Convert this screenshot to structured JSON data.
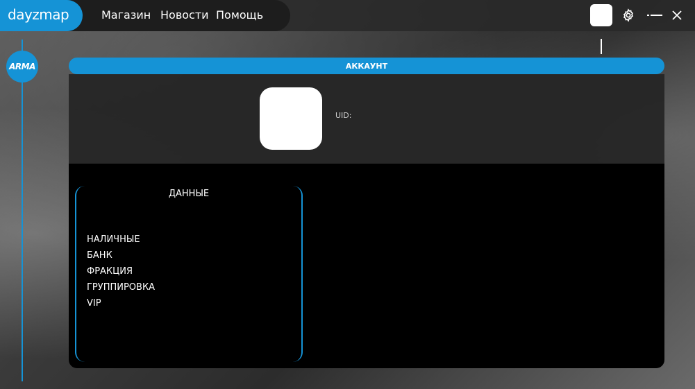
{
  "app": {
    "logo": "dayzmap"
  },
  "nav": {
    "items": [
      {
        "label": "Магазин"
      },
      {
        "label": "Новости"
      },
      {
        "label": "Помощь"
      }
    ]
  },
  "window_controls": {
    "settings_icon": "gear-icon",
    "minimize_icon": "minimize-icon",
    "close_icon": "close-icon"
  },
  "sidebar": {
    "game_badge": "ARMA"
  },
  "panel": {
    "header": "АККАУНТ",
    "uid_label": "UID:"
  },
  "data_card": {
    "title": "ДАННЫЕ",
    "rows": [
      {
        "label": "НАЛИЧНЫЕ"
      },
      {
        "label": "БАНК"
      },
      {
        "label": "ФРАКЦИЯ"
      },
      {
        "label": "ГРУППИРОВКА"
      },
      {
        "label": "VIP"
      }
    ]
  },
  "colors": {
    "accent": "#1593d6",
    "topbar": "#1d1d1d",
    "panel": "#262626",
    "content": "#000000"
  }
}
